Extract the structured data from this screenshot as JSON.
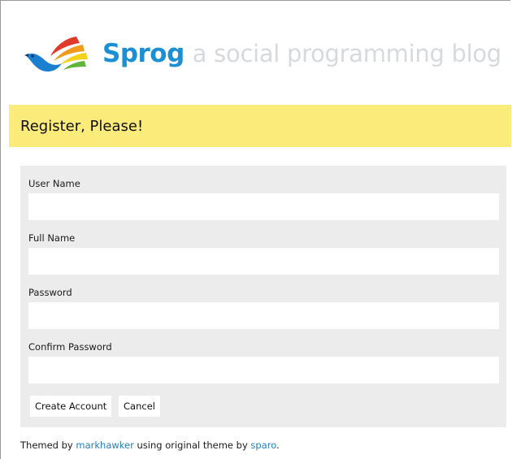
{
  "header": {
    "brand": "Sprog",
    "tagline": "a social programming blog"
  },
  "page": {
    "title": "Register, Please!"
  },
  "form": {
    "fields": [
      {
        "label": "User Name",
        "value": ""
      },
      {
        "label": "Full Name",
        "value": ""
      },
      {
        "label": "Password",
        "value": ""
      },
      {
        "label": "Confirm Password",
        "value": ""
      }
    ],
    "create_label": "Create Account",
    "cancel_label": "Cancel"
  },
  "footer": {
    "prefix": "Themed by ",
    "author_link": "markhawker",
    "middle": " using original theme by ",
    "original_link": "sparo",
    "suffix": "."
  },
  "colors": {
    "brand": "#1b8fd4",
    "banner": "#fbeb7a",
    "form_bg": "#ececec",
    "link": "#1f7fbf"
  }
}
